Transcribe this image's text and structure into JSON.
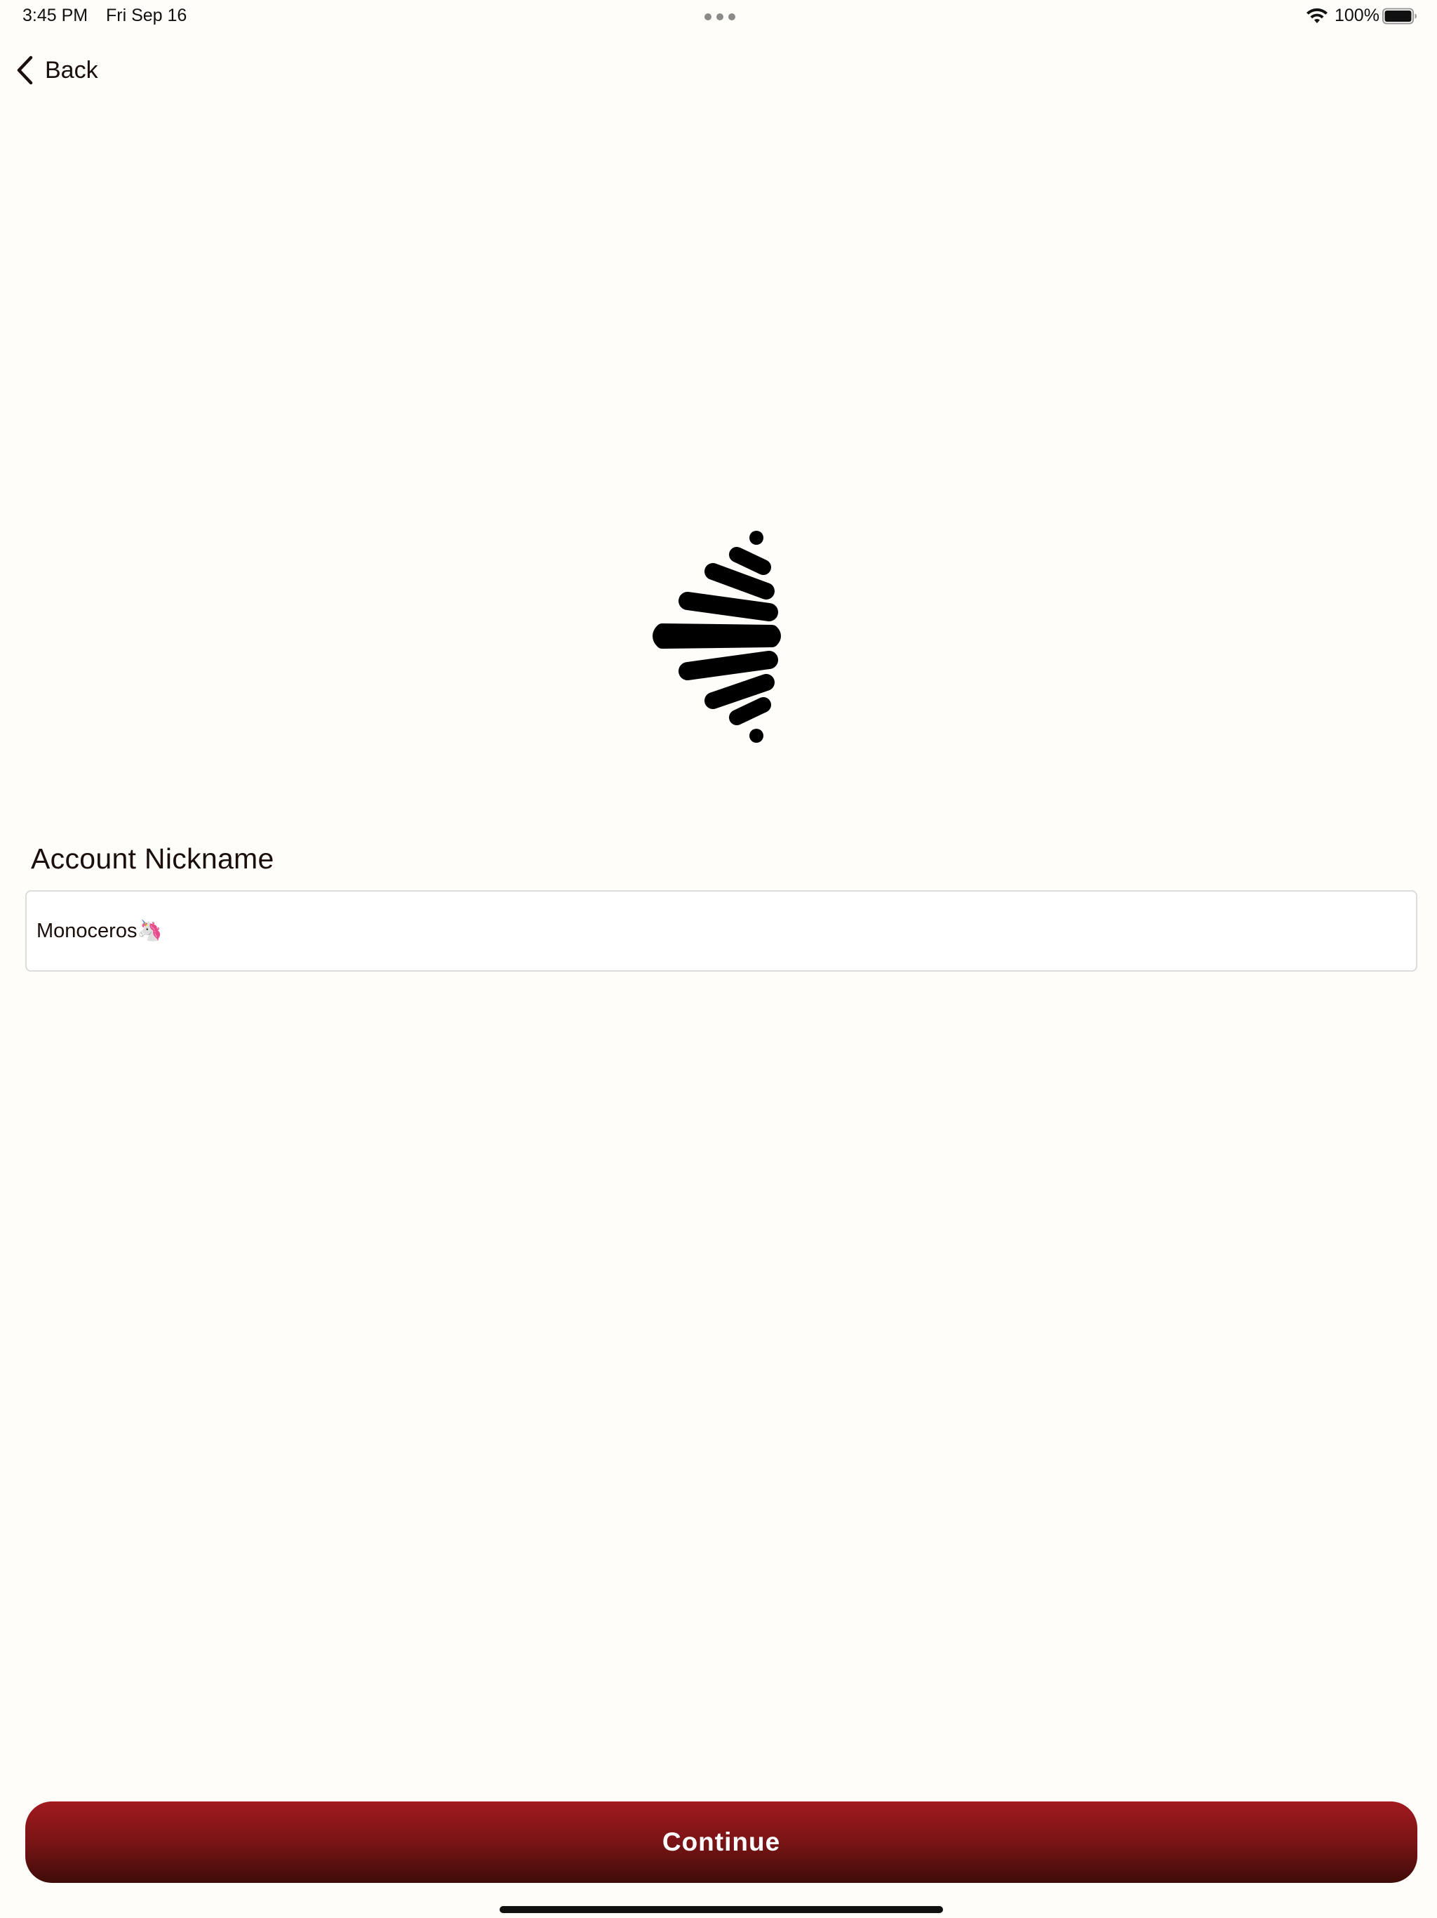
{
  "status_bar": {
    "time": "3:45 PM",
    "date": "Fri Sep 16",
    "battery_percent": "100%",
    "battery_level": 1.0,
    "icons": [
      "multitasking-dots-icon",
      "wifi-icon",
      "battery-icon"
    ]
  },
  "nav": {
    "back_label": "Back",
    "back_icon": "chevron-left-icon"
  },
  "logo": {
    "icon": "app-logo-icon",
    "color": "#000000"
  },
  "form": {
    "nickname_label": "Account Nickname",
    "nickname_value": "Monoceros🦄"
  },
  "actions": {
    "continue_label": "Continue"
  },
  "colors": {
    "background": "#fefdf9",
    "button_top": "#a11a1f",
    "button_bottom": "#3e0c09",
    "text": "#1a0f0b",
    "field_border": "#dcdcdc"
  }
}
